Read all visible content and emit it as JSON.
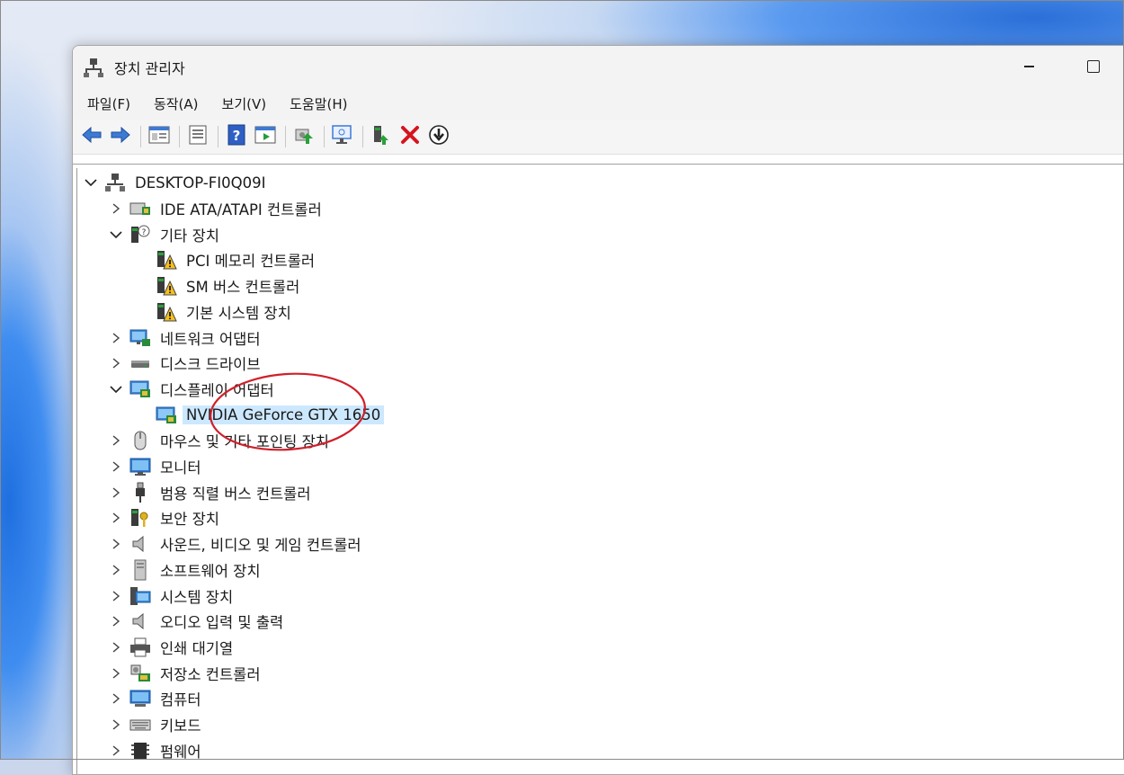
{
  "window": {
    "title": "장치 관리자"
  },
  "menu": [
    "파일(F)",
    "동작(A)",
    "보기(V)",
    "도움말(H)"
  ],
  "toolbar": [
    {
      "name": "back-icon"
    },
    {
      "name": "forward-icon"
    },
    {
      "sep": true
    },
    {
      "name": "show-hide-tree-icon"
    },
    {
      "sep": true
    },
    {
      "name": "properties-icon"
    },
    {
      "sep": true
    },
    {
      "name": "help-icon"
    },
    {
      "name": "action-pane-icon"
    },
    {
      "sep": true
    },
    {
      "name": "update-driver-icon"
    },
    {
      "sep": true
    },
    {
      "name": "scan-hardware-icon"
    },
    {
      "sep": true
    },
    {
      "name": "enable-device-icon"
    },
    {
      "name": "uninstall-device-icon"
    },
    {
      "name": "disable-device-icon"
    }
  ],
  "tree": {
    "root": "DESKTOP-FI0Q09I",
    "items": [
      {
        "label": "IDE ATA/ATAPI 컨트롤러",
        "level": 1,
        "expander": "collapsed",
        "icon": "ide-controller-icon"
      },
      {
        "label": "기타 장치",
        "level": 1,
        "expander": "expanded",
        "icon": "other-devices-icon"
      },
      {
        "label": "PCI 메모리 컨트롤러",
        "level": 2,
        "expander": "none",
        "icon": "warning-device-icon"
      },
      {
        "label": "SM 버스 컨트롤러",
        "level": 2,
        "expander": "none",
        "icon": "warning-device-icon"
      },
      {
        "label": "기본 시스템 장치",
        "level": 2,
        "expander": "none",
        "icon": "warning-device-icon"
      },
      {
        "label": "네트워크 어댑터",
        "level": 1,
        "expander": "collapsed",
        "icon": "network-adapter-icon"
      },
      {
        "label": "디스크 드라이브",
        "level": 1,
        "expander": "collapsed",
        "icon": "disk-drive-icon"
      },
      {
        "label": "디스플레이 어댑터",
        "level": 1,
        "expander": "expanded",
        "icon": "display-adapter-icon"
      },
      {
        "label": "NVIDIA GeForce GTX 1650",
        "level": 2,
        "expander": "none",
        "icon": "display-adapter-icon",
        "selected": true
      },
      {
        "label": "마우스 및 기타 포인팅 장치",
        "level": 1,
        "expander": "collapsed",
        "icon": "mouse-icon"
      },
      {
        "label": "모니터",
        "level": 1,
        "expander": "collapsed",
        "icon": "monitor-icon"
      },
      {
        "label": "범용 직렬 버스 컨트롤러",
        "level": 1,
        "expander": "collapsed",
        "icon": "usb-icon"
      },
      {
        "label": "보안 장치",
        "level": 1,
        "expander": "collapsed",
        "icon": "security-device-icon"
      },
      {
        "label": "사운드, 비디오 및 게임 컨트롤러",
        "level": 1,
        "expander": "collapsed",
        "icon": "speaker-icon"
      },
      {
        "label": "소프트웨어 장치",
        "level": 1,
        "expander": "collapsed",
        "icon": "software-device-icon"
      },
      {
        "label": "시스템 장치",
        "level": 1,
        "expander": "collapsed",
        "icon": "system-device-icon"
      },
      {
        "label": "오디오 입력 및 출력",
        "level": 1,
        "expander": "collapsed",
        "icon": "speaker-icon"
      },
      {
        "label": "인쇄 대기열",
        "level": 1,
        "expander": "collapsed",
        "icon": "printer-icon"
      },
      {
        "label": "저장소 컨트롤러",
        "level": 1,
        "expander": "collapsed",
        "icon": "storage-controller-icon"
      },
      {
        "label": "컴퓨터",
        "level": 1,
        "expander": "collapsed",
        "icon": "computer-icon"
      },
      {
        "label": "키보드",
        "level": 1,
        "expander": "collapsed",
        "icon": "keyboard-icon"
      },
      {
        "label": "펌웨어",
        "level": 1,
        "expander": "collapsed",
        "icon": "firmware-icon"
      }
    ]
  },
  "colors": {
    "selection": "#cce8ff",
    "annotation": "#d0202a"
  }
}
